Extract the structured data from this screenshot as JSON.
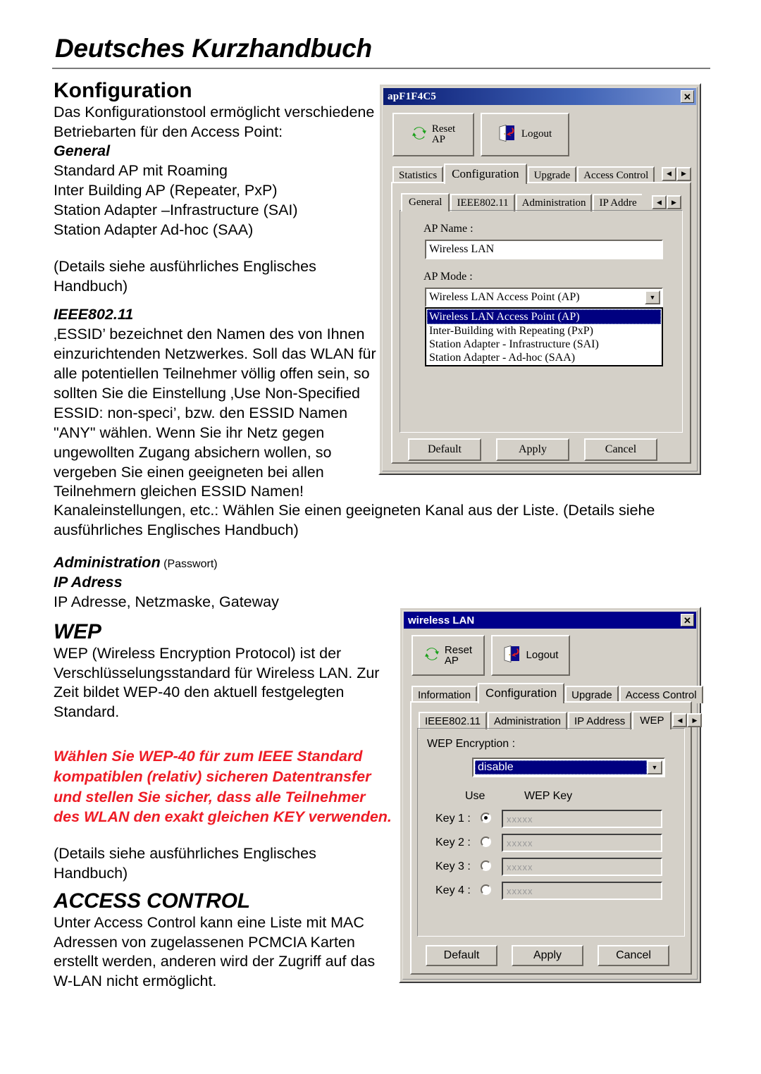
{
  "document": {
    "title": "Deutsches Kurzhandbuch",
    "sections": {
      "konfiguration": {
        "heading": "Konfiguration",
        "intro": "Das Konfigurationstool ermöglicht verschiedene Betriebarten für den Access Point:",
        "general_label": "General",
        "general_items": [
          "Standard AP mit Roaming",
          "Inter Building  AP (Repeater, PxP)",
          "Station Adapter –Infrastructure (SAI)",
          "Station Adapter Ad-hoc (SAA)"
        ],
        "details_note": "(Details siehe ausführliches Englisches Handbuch)",
        "ieee_label": "IEEE802.11",
        "ieee_text": "‚ESSID’ bezeichnet den Namen des von Ihnen einzurichtenden Netzwerkes. Soll das WLAN für alle potentiellen Teilnehmer völlig offen sein, so sollten Sie die Einstellung ‚Use Non-Specified ESSID: non-speci’, bzw. den ESSID Namen \"ANY\" wählen. Wenn Sie ihr Netz gegen ungewollten Zugang absichern wollen, so vergeben Sie einen geeigneten bei allen Teilnehmern gleichen ESSID Namen!",
        "kanal_text": "Kanaleinstellungen, etc.: Wählen Sie einen geeigneten Kanal aus der Liste.  (Details siehe ausführliches Englisches Handbuch)",
        "administration_label": "Administration",
        "administration_suffix": " (Passwort)",
        "ip_label": "IP Adress",
        "ip_text": "IP Adresse, Netzmaske, Gateway"
      },
      "wep": {
        "heading": "WEP",
        "text": "WEP (Wireless Encryption Protocol) ist der Verschlüsselungsstandard für Wireless LAN. Zur Zeit bildet WEP-40 den aktuell festgelegten Standard.",
        "warning": "Wählen Sie WEP-40 für zum IEEE Standard kompatiblen (relativ) sicheren  Datentransfer und stellen Sie sicher, dass alle Teilnehmer des WLAN den exakt gleichen KEY verwenden.",
        "warning_color": "#ee1c25",
        "details_note": "(Details siehe ausführliches Englisches Handbuch)"
      },
      "access_control": {
        "heading": "ACCESS CONTROL",
        "text": "Unter Access Control kann eine Liste mit MAC Adressen von zugelassenen PCMCIA Karten erstellt werden, anderen wird der Zugriff auf das W-LAN nicht ermöglicht."
      }
    }
  },
  "dialog_general": {
    "title": "apF1F4C5",
    "close_label": "✕",
    "toolbar": {
      "reset_label": "Reset\nAP",
      "logout_label": "Logout"
    },
    "outer_tabs": [
      "Statistics",
      "Configuration",
      "Upgrade",
      "Access Control"
    ],
    "outer_active_tab": "Configuration",
    "inner_tabs": [
      "General",
      "IEEE802.11",
      "Administration",
      "IP Addre"
    ],
    "inner_active_tab": "General",
    "spinner_left": "◀",
    "spinner_right": "▶",
    "ap_name_label": "AP Name :",
    "ap_name_value": "Wireless LAN",
    "ap_mode_label": "AP Mode :",
    "ap_mode_value": "Wireless LAN Access Point (AP)",
    "ap_mode_options": [
      "Wireless LAN Access Point (AP)",
      "Inter-Building with Repeating (PxP)",
      "Station Adapter - Infrastructure (SAI)",
      "Station Adapter - Ad-hoc (SAA)"
    ],
    "ap_mode_selected_index": 0,
    "buttons": [
      "Default",
      "Apply",
      "Cancel"
    ]
  },
  "dialog_wep": {
    "title": "wireless LAN",
    "close_label": "✕",
    "toolbar": {
      "reset_label": "Reset\nAP",
      "logout_label": "Logout"
    },
    "outer_tabs": [
      "Information",
      "Configuration",
      "Upgrade",
      "Access Control"
    ],
    "outer_active_tab": "Configuration",
    "inner_tabs": [
      "IEEE802.11",
      "Administration",
      "IP Address",
      "WEP"
    ],
    "inner_active_tab": "WEP",
    "spinner_left": "◀",
    "spinner_right": "▶",
    "encryption_label": "WEP Encryption :",
    "encryption_value": "disable",
    "col_use": "Use",
    "col_key": "WEP Key",
    "keys": [
      {
        "label": "Key 1 :",
        "selected": true,
        "value": "xxxxx"
      },
      {
        "label": "Key 2 :",
        "selected": false,
        "value": "xxxxx"
      },
      {
        "label": "Key 3 :",
        "selected": false,
        "value": "xxxxx"
      },
      {
        "label": "Key 4 :",
        "selected": false,
        "value": "xxxxx"
      }
    ],
    "buttons": [
      "Default",
      "Apply",
      "Cancel"
    ]
  }
}
